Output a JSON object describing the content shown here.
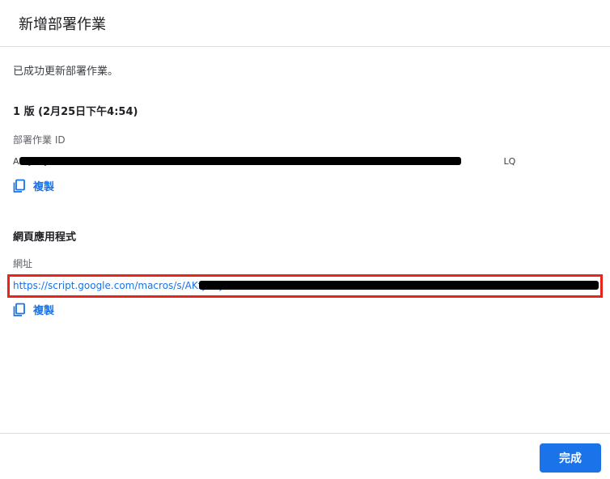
{
  "dialog": {
    "title": "新增部署作業"
  },
  "success_message": "已成功更新部署作業。",
  "version_label": "1 版 (2月25日下午4:54)",
  "deployment": {
    "id_label": "部署作業 ID",
    "id_value_visible_start": "AKfycby",
    "id_value_visible_end": "LQ",
    "copy_label": "複製"
  },
  "web_app": {
    "section_title": "網頁應用程式",
    "url_label": "網址",
    "url_value": "https://script.google.com/macros/s/AKfycbyxxxxxxxxxxxxxxxxxxxxxxxxxxxxxxxxxxxxxxxxxxxxxxxxxx02…",
    "copy_label": "複製"
  },
  "footer": {
    "done_label": "完成"
  },
  "colors": {
    "accent": "#1a73e8",
    "highlight": "#e8251b",
    "redaction": "#000000"
  },
  "icons": {
    "copy": "copy-icon"
  }
}
